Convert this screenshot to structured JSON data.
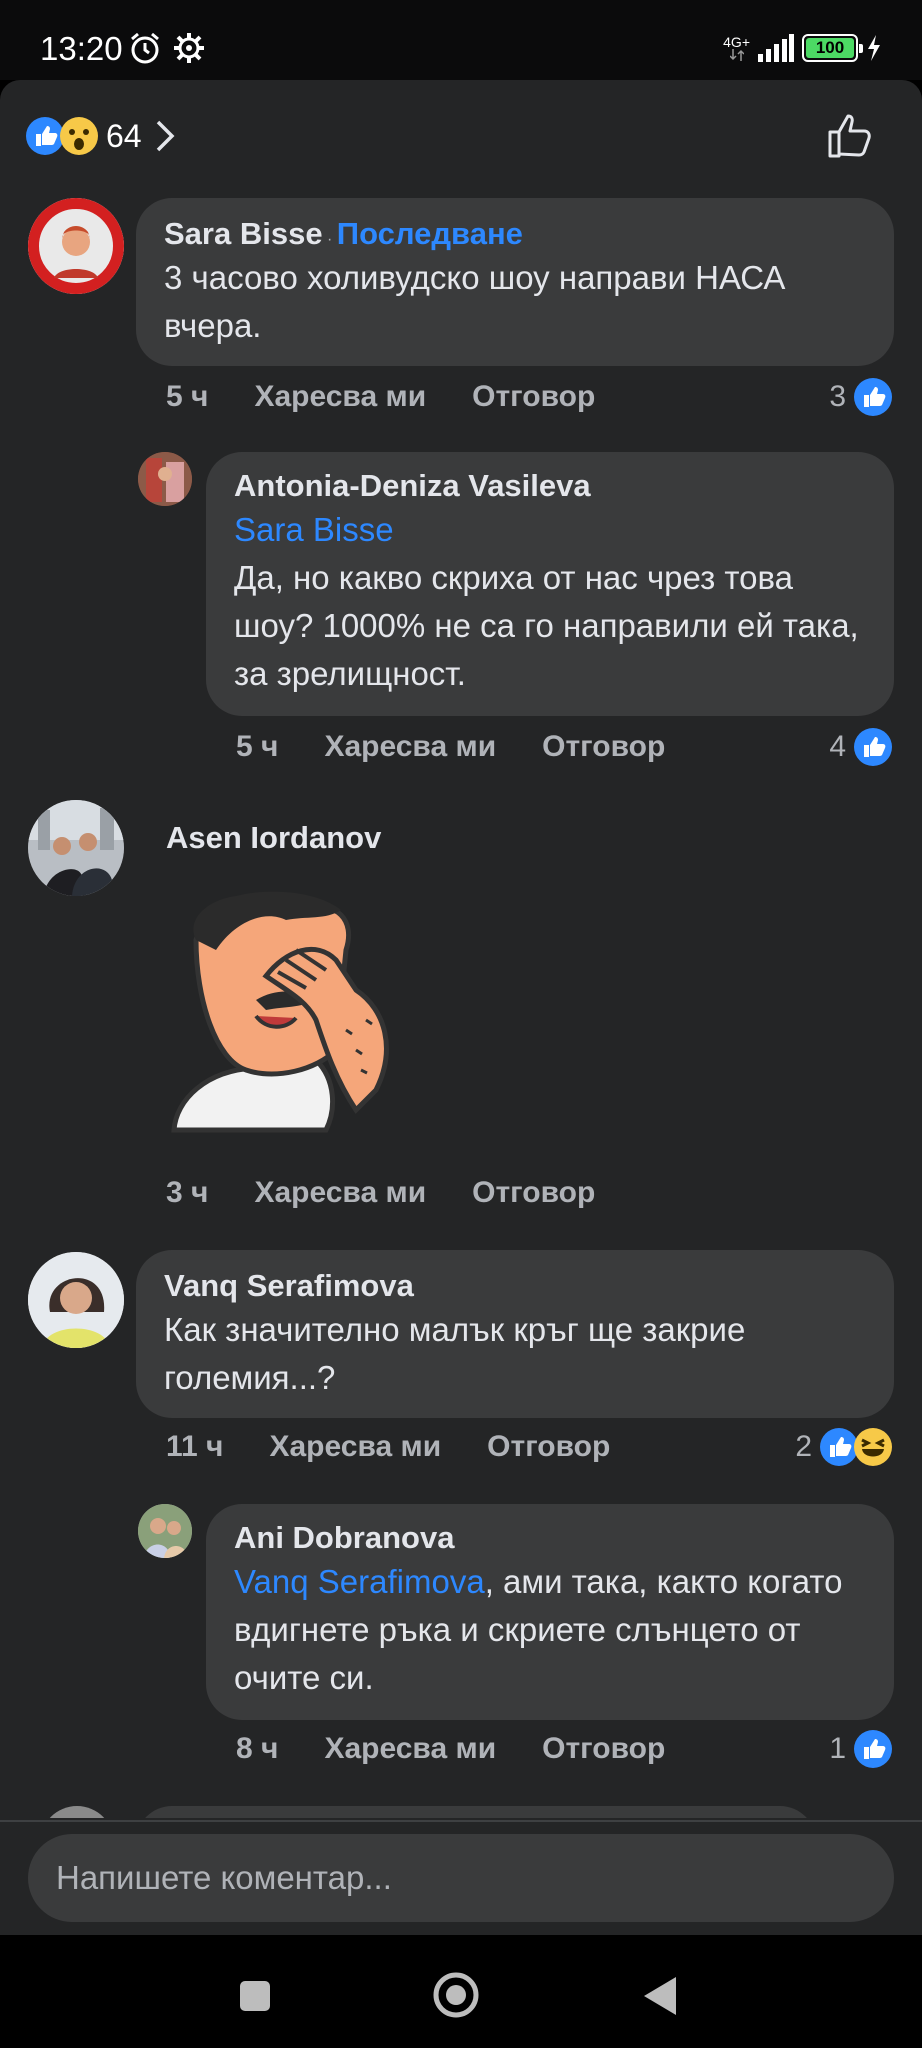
{
  "status": {
    "time": "13:20",
    "network": "4G+",
    "battery": "100"
  },
  "reactions": {
    "count": "64"
  },
  "comments": [
    {
      "author": "Sara Bisse",
      "separator": "·",
      "follow": "Последване",
      "text": "3 часово холивудско шоу направи НАСА вчера.",
      "time": "5 ч",
      "like": "Харесва ми",
      "reply": "Отговор",
      "reactions": "3"
    },
    {
      "author": "Antonia-Deniza Vasileva",
      "mention": "Sara Bisse",
      "text": "Да, но какво скриха от нас чрез това шоу? 1000% не са го направили ей така, за зрелищност.",
      "time": "5 ч",
      "like": "Харесва ми",
      "reply": "Отговор",
      "reactions": "4"
    },
    {
      "author": "Asen Iordanov",
      "time": "3 ч",
      "like": "Харесва ми",
      "reply": "Отговор"
    },
    {
      "author": "Vanq Serafimova",
      "text": "Как значително малък кръг ще закрие големия...?",
      "time": "11 ч",
      "like": "Харесва ми",
      "reply": "Отговор",
      "reactions": "2"
    },
    {
      "author": "Ani Dobranova",
      "mention": "Vanq Serafimova",
      "text": ", ами така, както когато вдигнете ръка и скриете слънцето от очите си.",
      "time": "8 ч",
      "like": "Харесва ми",
      "reply": "Отговор",
      "reactions": "1"
    }
  ],
  "composer": {
    "placeholder": "Напишете коментар..."
  },
  "colors": {
    "background": "#242526",
    "bubble": "#3a3b3c",
    "accent": "#2d88ff",
    "muted": "#b0b3b8"
  }
}
